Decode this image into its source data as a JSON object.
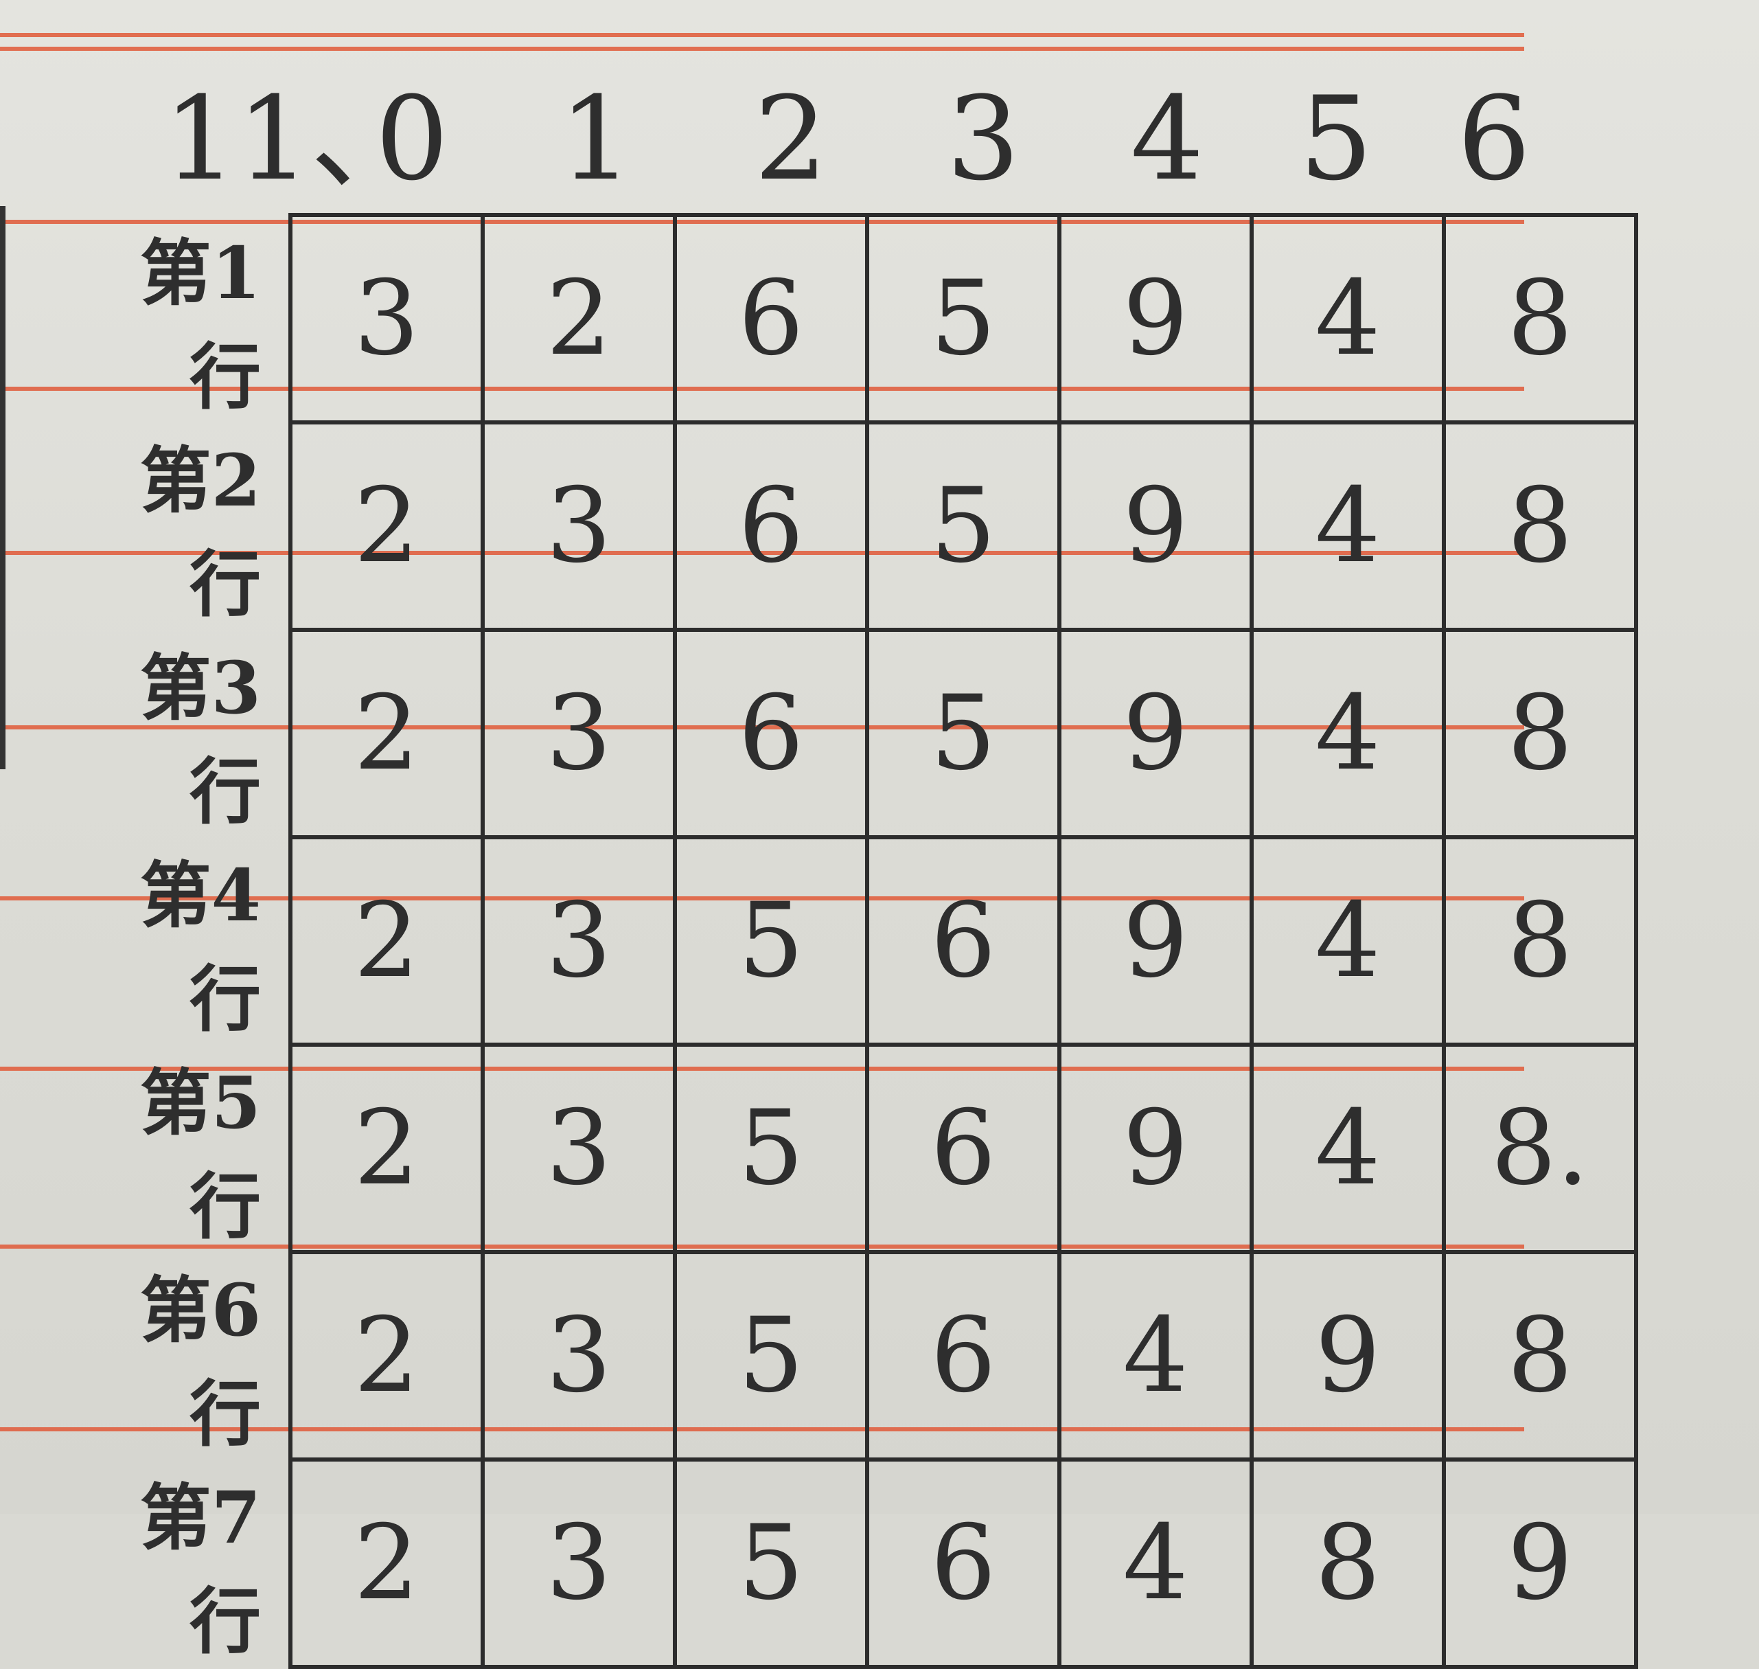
{
  "question_number": "11、",
  "column_headers": [
    "0",
    "1",
    "2",
    "3",
    "4",
    "5",
    "6"
  ],
  "rows": [
    {
      "label": "第1行",
      "cells": [
        "3",
        "2",
        "6",
        "5",
        "9",
        "4",
        "8"
      ]
    },
    {
      "label": "第2行",
      "cells": [
        "2",
        "3",
        "6",
        "5",
        "9",
        "4",
        "8"
      ]
    },
    {
      "label": "第3行",
      "cells": [
        "2",
        "3",
        "6",
        "5",
        "9",
        "4",
        "8"
      ]
    },
    {
      "label": "第4行",
      "cells": [
        "2",
        "3",
        "5",
        "6",
        "9",
        "4",
        "8"
      ]
    },
    {
      "label": "第5行",
      "cells": [
        "2",
        "3",
        "5",
        "6",
        "9",
        "4",
        "8."
      ]
    },
    {
      "label": "第6行",
      "cells": [
        "2",
        "3",
        "5",
        "6",
        "4",
        "9",
        "8"
      ]
    },
    {
      "label": "第7行",
      "cells": [
        "2",
        "3",
        "5",
        "6",
        "4",
        "8",
        "9"
      ]
    }
  ],
  "colors": {
    "ink": "#2e2e2e",
    "rule": "#e06040",
    "paper": "#e0e0da"
  }
}
